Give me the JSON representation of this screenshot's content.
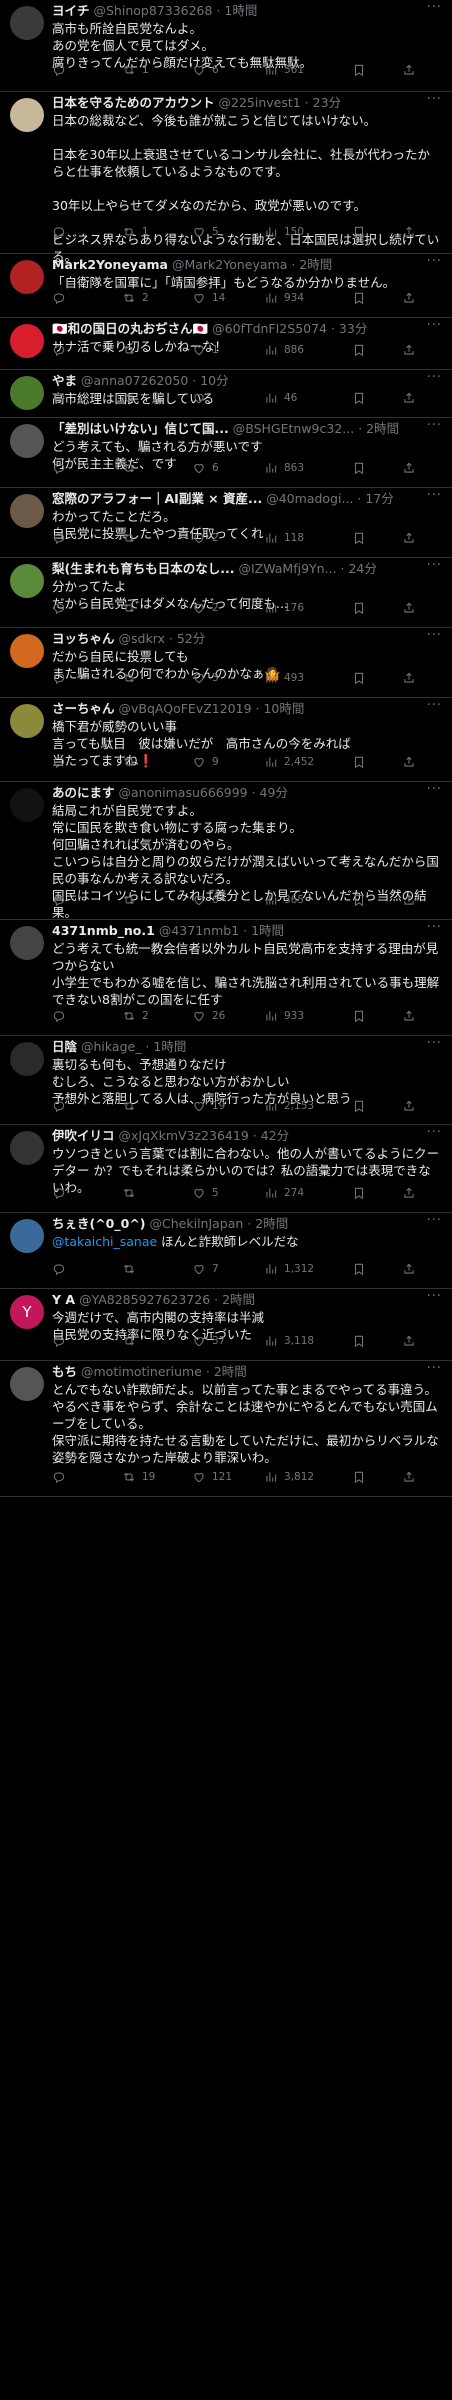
{
  "feed": {
    "tweets": [
      {
        "name": "ヨイチ",
        "handle": "@Shinop87336268",
        "time": "1時間",
        "text": "高市も所詮自民党なんよ。\nあの党を個人で見てはダメ。\n腐りきってんだから顔だけ変えても無駄無駄。",
        "reply": "",
        "retweet": "1",
        "like": "6",
        "views": "561",
        "avatar_color": "#3a3a3a"
      },
      {
        "name": "日本を守るためのアカウント",
        "handle": "@225invest1",
        "time": "23分",
        "text": "日本の総裁など、今後も誰が就こうと信じてはいけない。\n\n日本を30年以上衰退させているコンサル会社に、社長が代わったからと仕事を依頼しているようなものです。\n\n30年以上やらせてダメなのだから、政党が悪いのです。\n\nビジネス界ならあり得ないような行動を、日本国民は選択し続けている。",
        "reply": "",
        "retweet": "1",
        "like": "5",
        "views": "150",
        "avatar_color": "#c8b89a"
      },
      {
        "name": "Mark2Yoneyama",
        "handle": "@Mark2Yoneyama",
        "time": "2時間",
        "text": "「自衛隊を国軍に」「靖国参拝」もどうなるか分かりません。",
        "reply": "",
        "retweet": "2",
        "like": "14",
        "views": "934",
        "avatar_color": "#b22222"
      },
      {
        "name": "🇯🇵和の国日の丸おぢさん🇯🇵",
        "handle": "@60fTdnFI2S5074",
        "time": "33分",
        "text": "サナ活で乗り切るしかねーな！",
        "reply": "",
        "retweet": "",
        "like": "1",
        "views": "886",
        "avatar_color": "#d81e2c"
      },
      {
        "name": "やま",
        "handle": "@anna07262050",
        "time": "10分",
        "text": "高市総理は国民を騙している",
        "reply": "",
        "retweet": "",
        "like": "",
        "views": "46",
        "avatar_color": "#4a7a2a"
      },
      {
        "name": "「差別はいけない」信じて国...",
        "handle": "@BSHGEtnw9c32...",
        "time": "2時間",
        "text": "どう考えても、騙される方が悪いです\n何が民主主義だ、です",
        "reply": "",
        "retweet": "",
        "like": "6",
        "views": "863",
        "avatar_color": "#555"
      },
      {
        "name": "窓際のアラフォー｜AI副業 × 資産...",
        "handle": "@40madogi...",
        "time": "17分",
        "text": "わかってたことだろ。\n自民党に投票したやつ責任取ってくれ",
        "reply": "",
        "retweet": "",
        "like": "2",
        "views": "118",
        "avatar_color": "#6b5a4a"
      },
      {
        "name": "梨(生まれも育ちも日本のなし...",
        "handle": "@IZWaMfj9Yn...",
        "time": "24分",
        "text": "分かってたよ\nだから自民党ではダメなんだって何度も...",
        "reply": "",
        "retweet": "",
        "like": "2",
        "views": "176",
        "avatar_color": "#5a8a3a"
      },
      {
        "name": "ヨッちゃん",
        "handle": "@sdkrx",
        "time": "52分",
        "text": "だから自民に投票しても\nまた騙されるの何でわからんのかなぁ🤷",
        "reply": "",
        "retweet": "",
        "like": "3",
        "views": "493",
        "avatar_color": "#d2691e"
      },
      {
        "name": "さーちゃん",
        "handle": "@vBqAQoFEvZ12019",
        "time": "10時間",
        "text": "橋下君が威勢のいい事\n言っても駄目　彼は嫌いだが　高市さんの今をみれば\n当たってますね❗",
        "reply": "",
        "retweet": "",
        "like": "9",
        "views": "2,452",
        "avatar_color": "#8a8a3a"
      },
      {
        "name": "あのにます",
        "handle": "@anonimasu666999",
        "time": "49分",
        "text": "結局これが自民党ですよ。\n常に国民を欺き食い物にする腐った集まり。\n何回騙されれば気が済むのやら。\nこいつらは自分と周りの奴らだけが潤えばいいって考えなんだから国民の事なんか考える訳ないだろ。\n国民はコイツらにしてみれば養分としか見てないんだから当然の結果。",
        "reply": "",
        "retweet": "",
        "like": "6",
        "views": "365",
        "avatar_color": "#111"
      },
      {
        "name": "4371nmb_no.1",
        "handle": "@4371nmb1",
        "time": "1時間",
        "text": "どう考えても統一教会信者以外カルト自民党高市を支持する理由が見つからない\n小学生でもわかる嘘を信じ、騙され洗脳され利用されている事も理解できない8割がこの国をに任す",
        "reply": "",
        "retweet": "2",
        "like": "26",
        "views": "933",
        "avatar_color": "#444"
      },
      {
        "name": "日陰",
        "handle": "@hikage_",
        "time": "1時間",
        "text": "裏切るも何も、予想通りなだけ\nむしろ、こうなると思わない方がおかしい\n予想外と落胆してる人は、病院行った方が良いと思う",
        "reply": "",
        "retweet": "",
        "like": "19",
        "views": "2,153",
        "avatar_color": "#2a2a2a"
      },
      {
        "name": "伊吹イリコ",
        "handle": "@xJqXkmV3z236419",
        "time": "42分",
        "text": "ウソつきという言葉では割に合わない。他の人が書いてるようにクーデター か？でもそれは柔らかいのでは？私の語彙力では表現できないわ。",
        "reply": "",
        "retweet": "",
        "like": "5",
        "views": "274",
        "avatar_color": "#333"
      },
      {
        "name": "ちぇき(^0_0^)",
        "handle": "@ChekilnJapan",
        "time": "2時間",
        "text": "@takaichi_sanae ほんと詐欺師レベルだな",
        "mention": "@takaichi_sanae",
        "reply": "",
        "retweet": "",
        "like": "7",
        "views": "1,312",
        "avatar_color": "#3a6a9a"
      },
      {
        "name": "Y A",
        "handle": "@YA8285927623726",
        "time": "2時間",
        "text": "今週だけで、高市内閣の支持率は半減\n自民党の支持率に限りなく近づいた",
        "reply": "",
        "retweet": "",
        "like": "37",
        "views": "3,118",
        "avatar_color": "#c2185b",
        "avatar_letter": "Y"
      },
      {
        "name": "もち",
        "handle": "@motimotineriume",
        "time": "2時間",
        "text": "とんでもない詐欺師だよ。以前言ってた事とまるでやってる事違う。\nやるべき事をやらず、余計なことは速やかにやるとんでもない売国ムーブをしている。\n保守派に期待を持たせる言動をしていただけに、最初からリベラルな姿勢を隠さなかった岸破より罪深いわ。",
        "reply": "",
        "retweet": "19",
        "like": "121",
        "views": "3,812",
        "avatar_color": "#555"
      }
    ]
  },
  "colors": {
    "background": "#000000",
    "text": "#e7e9ea",
    "secondary": "#71767b",
    "link": "#1d9bf0",
    "divider": "#2f3336"
  },
  "icons": {
    "reply": "reply-icon",
    "retweet": "retweet-icon",
    "like": "heart-icon",
    "views": "views-icon",
    "bookmark": "bookmark-icon",
    "share": "share-icon",
    "more": "more-icon"
  }
}
